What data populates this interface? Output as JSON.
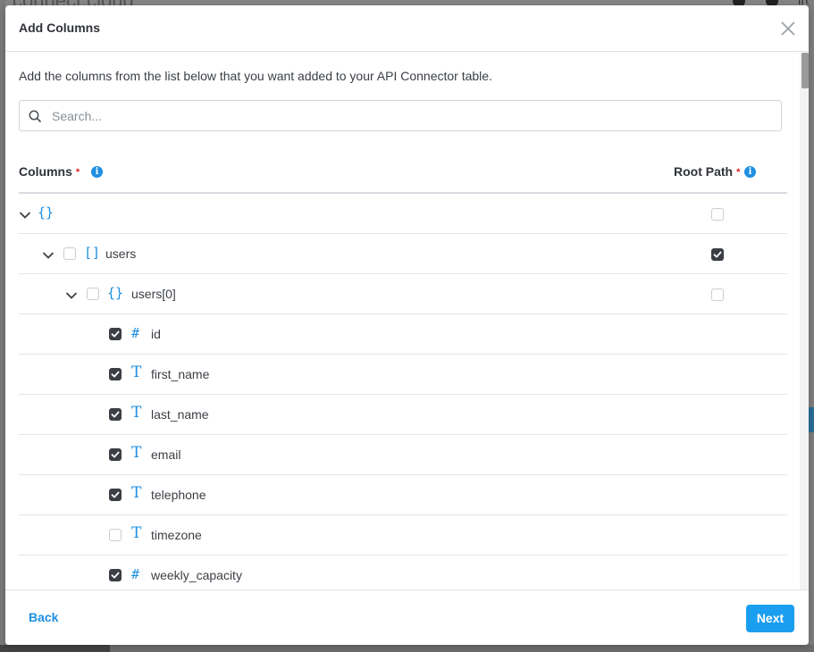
{
  "background": {
    "brand_text": "connect.cloud",
    "right_text": "irc"
  },
  "modal": {
    "title": "Add Columns",
    "intro": "Add the columns from the list below that you want added to your API Connector table.",
    "search": {
      "placeholder": "Search...",
      "value": ""
    },
    "headers": {
      "columns": "Columns",
      "root_path": "Root Path",
      "required_mark": "*",
      "info_glyph": "i"
    },
    "rows": [
      {
        "label": "",
        "type_icon": "{}",
        "icon_name": "object-icon",
        "level": 0,
        "expandable": true,
        "checkbox": null,
        "root_path": false
      },
      {
        "label": "users",
        "type_icon": "[]",
        "icon_name": "array-icon",
        "level": 1,
        "expandable": true,
        "checkbox": false,
        "root_path": true
      },
      {
        "label": "users[0]",
        "type_icon": "{}",
        "icon_name": "object-icon",
        "level": 2,
        "expandable": true,
        "checkbox": false,
        "root_path": false
      },
      {
        "label": "id",
        "type_icon": "#",
        "icon_name": "number-icon",
        "level": 3,
        "expandable": false,
        "checkbox": true,
        "root_path": null
      },
      {
        "label": "first_name",
        "type_icon": "T",
        "icon_name": "text-icon",
        "level": 3,
        "expandable": false,
        "checkbox": true,
        "root_path": null
      },
      {
        "label": "last_name",
        "type_icon": "T",
        "icon_name": "text-icon",
        "level": 3,
        "expandable": false,
        "checkbox": true,
        "root_path": null
      },
      {
        "label": "email",
        "type_icon": "T",
        "icon_name": "text-icon",
        "level": 3,
        "expandable": false,
        "checkbox": true,
        "root_path": null
      },
      {
        "label": "telephone",
        "type_icon": "T",
        "icon_name": "text-icon",
        "level": 3,
        "expandable": false,
        "checkbox": true,
        "root_path": null
      },
      {
        "label": "timezone",
        "type_icon": "T",
        "icon_name": "text-icon",
        "level": 3,
        "expandable": false,
        "checkbox": false,
        "root_path": null
      },
      {
        "label": "weekly_capacity",
        "type_icon": "#",
        "icon_name": "number-icon",
        "level": 3,
        "expandable": false,
        "checkbox": true,
        "root_path": null
      }
    ],
    "footer": {
      "back_label": "Back",
      "next_label": "Next"
    }
  },
  "colors": {
    "accent": "#1e8fe1",
    "primary_button": "#1a9ef0",
    "checkbox_checked": "#3b3f45",
    "required": "#e02020"
  }
}
